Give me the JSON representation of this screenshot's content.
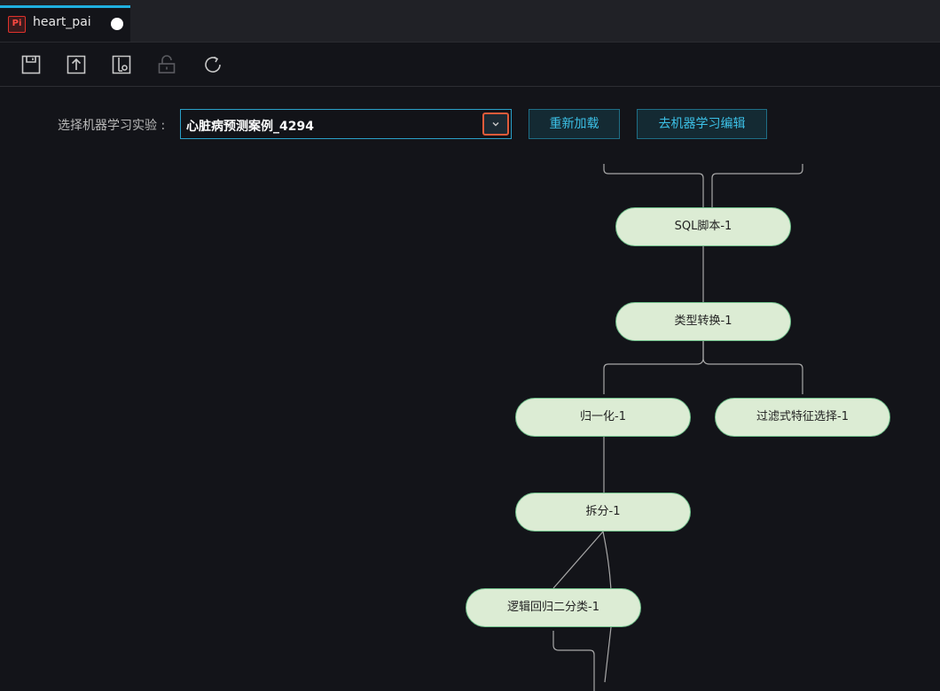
{
  "tab": {
    "icon_text": "Pi",
    "title": "heart_pai",
    "icon": "pai-file-icon"
  },
  "toolbar": {
    "icons": [
      "save-icon",
      "upload-icon",
      "deploy-icon",
      "lock-icon",
      "refresh-icon"
    ]
  },
  "selector": {
    "label": "选择机器学习实验 :",
    "value": "心脏病预测案例_4294"
  },
  "buttons": {
    "reload": "重新加载",
    "go_editor": "去机器学习编辑"
  },
  "nodes": {
    "sql": "SQL脚本-1",
    "type_convert": "类型转换-1",
    "normalize": "归一化-1",
    "feature_select": "过滤式特征选择-1",
    "split": "拆分-1",
    "logistic": "逻辑回归二分类-1"
  },
  "colors": {
    "accent": "#1fb0e0",
    "node_fill": "#dcecd4",
    "node_border": "#6fc08a",
    "highlight": "#e05b3a"
  }
}
